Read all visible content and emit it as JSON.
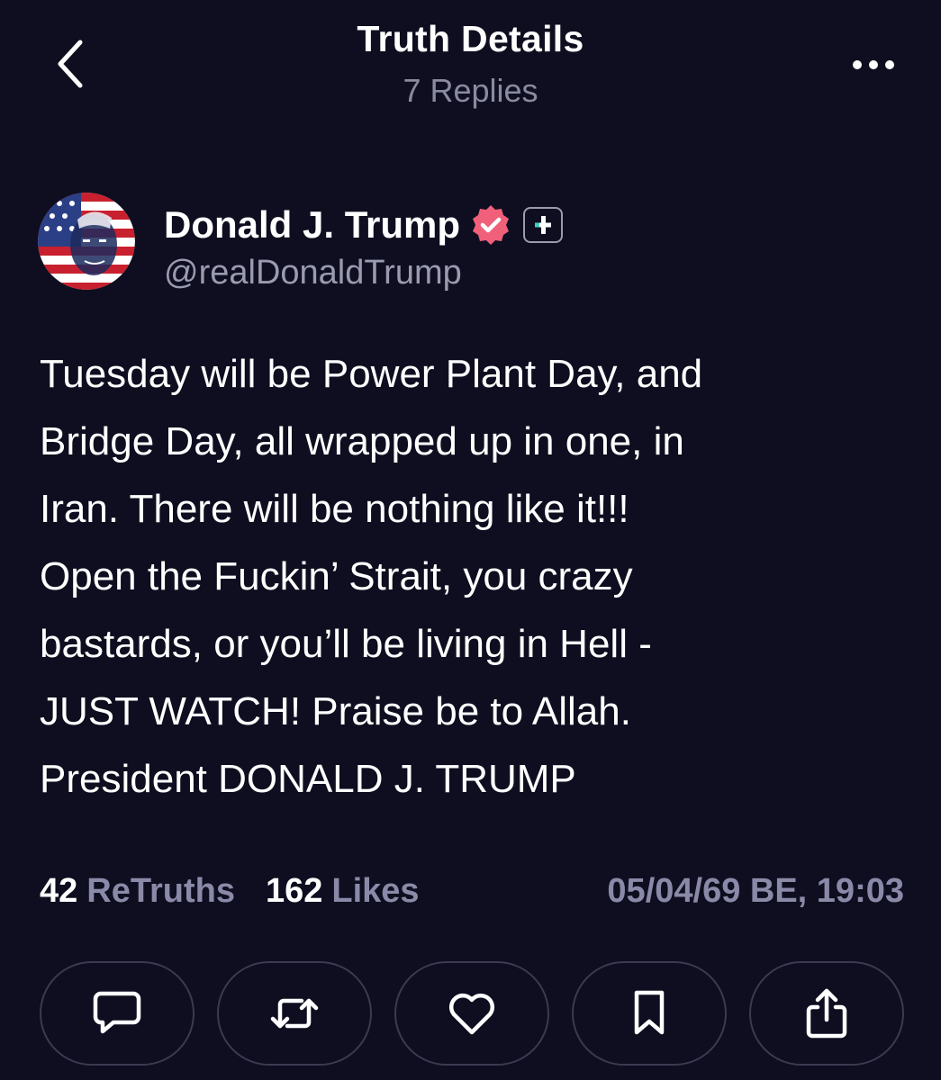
{
  "header": {
    "title": "Truth Details",
    "subtitle": "7 Replies"
  },
  "author": {
    "name": "Donald J. Trump",
    "handle": "@realDonaldTrump"
  },
  "post": {
    "text": "Tuesday will be Power Plant Day, and\nBridge Day, all wrapped up in one, in\nIran. There will be nothing like it!!!\nOpen the Fuckin’ Strait, you crazy\nbastards, or you’ll be living in Hell -\nJUST WATCH! Praise be to Allah.\nPresident DONALD J. TRUMP"
  },
  "stats": {
    "retruths_count": "42",
    "retruths_label": "ReTruths",
    "likes_count": "162",
    "likes_label": "Likes",
    "timestamp": "05/04/69 BE, 19:03"
  },
  "actions": [
    {
      "icon": "reply-icon"
    },
    {
      "icon": "retruth-icon"
    },
    {
      "icon": "heart-icon"
    },
    {
      "icon": "bookmark-icon"
    },
    {
      "icon": "share-icon"
    }
  ],
  "colors": {
    "background": "#0e0e20",
    "muted_text": "#8a8aa8",
    "verified_badge": "#f0607a",
    "button_border": "#3a3a52"
  }
}
